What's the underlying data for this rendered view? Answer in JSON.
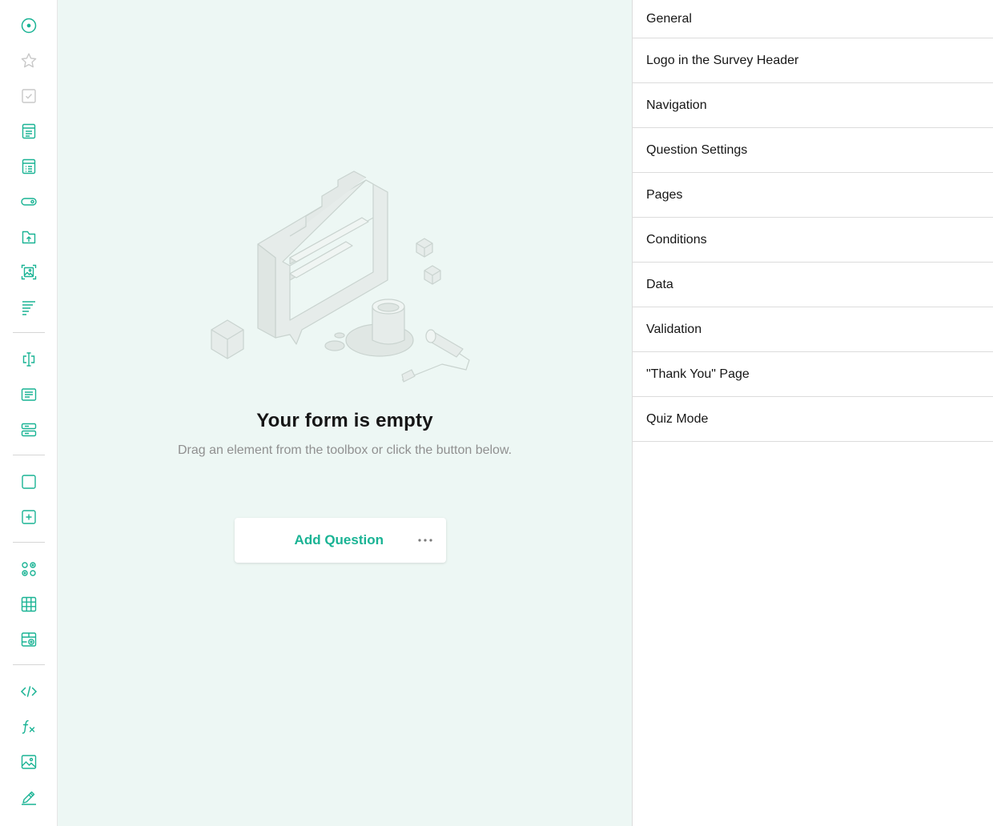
{
  "toolbox": {
    "items": [
      {
        "icon": "radiogroup-icon",
        "muted": false
      },
      {
        "icon": "rating-icon",
        "muted": true
      },
      {
        "icon": "checkbox-icon",
        "muted": true
      },
      {
        "icon": "dropdown-icon",
        "muted": false
      },
      {
        "icon": "tagbox-icon",
        "muted": false
      },
      {
        "icon": "boolean-toggle-icon",
        "muted": false
      },
      {
        "icon": "file-upload-icon",
        "muted": false
      },
      {
        "icon": "image-picker-icon",
        "muted": false
      },
      {
        "icon": "ranking-icon",
        "muted": false
      },
      {
        "icon": "single-line-text-icon",
        "muted": false
      },
      {
        "icon": "long-text-icon",
        "muted": false
      },
      {
        "icon": "multiple-textboxes-icon",
        "muted": false
      },
      {
        "icon": "panel-icon",
        "muted": false
      },
      {
        "icon": "dynamic-panel-icon",
        "muted": false
      },
      {
        "icon": "single-select-matrix-icon",
        "muted": false
      },
      {
        "icon": "multi-select-matrix-icon",
        "muted": false
      },
      {
        "icon": "dynamic-matrix-icon",
        "muted": false
      },
      {
        "icon": "html-icon",
        "muted": false
      },
      {
        "icon": "expression-icon",
        "muted": false
      },
      {
        "icon": "image-icon",
        "muted": false
      },
      {
        "icon": "signature-icon",
        "muted": false
      }
    ]
  },
  "canvas": {
    "empty_title": "Your form is empty",
    "empty_subtitle": "Drag an element from the toolbox or click the button below.",
    "add_question_label": "Add Question",
    "more_options_icon": "more-horizontal-icon"
  },
  "properties": {
    "categories": [
      "General",
      "Logo in the Survey Header",
      "Navigation",
      "Question Settings",
      "Pages",
      "Conditions",
      "Data",
      "Validation",
      "\"Thank You\" Page",
      "Quiz Mode"
    ]
  },
  "colors": {
    "accent": "#19b394",
    "canvas_background": "#edf7f4",
    "muted_icon": "#c8c8c8"
  }
}
